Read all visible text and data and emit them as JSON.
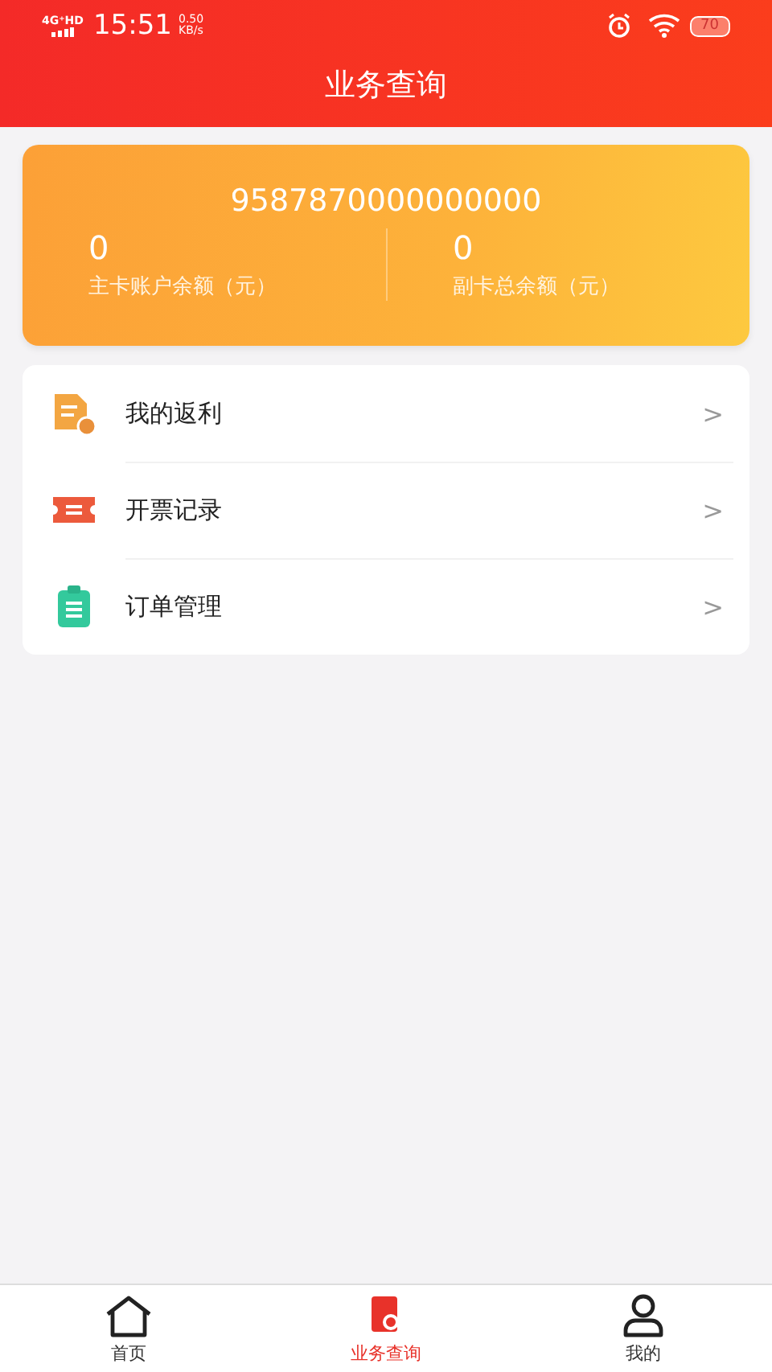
{
  "status_bar": {
    "network": "4G⁺HD",
    "time": "15:51",
    "speed_value": "0.50",
    "speed_unit": "KB/s",
    "battery": "70"
  },
  "header": {
    "title": "业务查询"
  },
  "card": {
    "number": "9587870000000000",
    "balances": [
      {
        "amount": "0",
        "label": "主卡账户余额（元）"
      },
      {
        "amount": "0",
        "label": "副卡总余额（元）"
      }
    ]
  },
  "menu": [
    {
      "kind": "rebate",
      "label": "我的返利",
      "chevron": ">"
    },
    {
      "kind": "invoice",
      "label": "开票记录",
      "chevron": ">"
    },
    {
      "kind": "order",
      "label": "订单管理",
      "chevron": ">"
    }
  ],
  "tab_bar": [
    {
      "kind": "home",
      "label": "首页",
      "selected": false
    },
    {
      "kind": "query",
      "label": "业务查询",
      "selected": true
    },
    {
      "kind": "profile",
      "label": "我的",
      "selected": false
    }
  ]
}
